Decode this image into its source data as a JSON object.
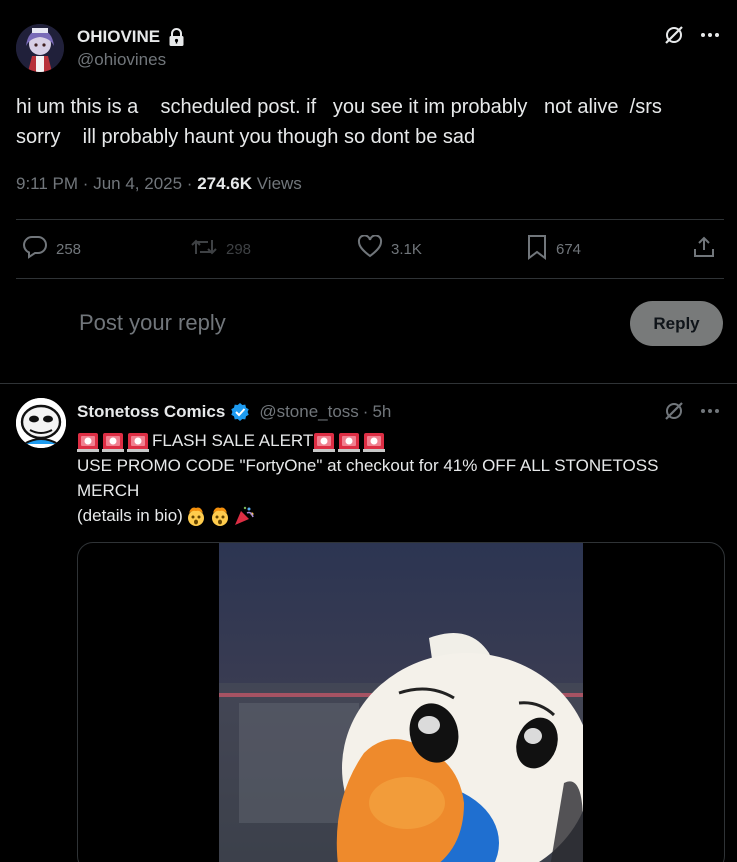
{
  "main_post": {
    "display_name": "OHIOVINE",
    "handle": "@ohiovines",
    "text": "hi um this is a    scheduled post. if   you see it im probably   not alive  /srs\nsorry    ill probably haunt you though so dont be sad",
    "time": "9:11 PM",
    "sep1": "·",
    "date": "Jun 4, 2025",
    "sep2": "·",
    "views_count": "274.6K",
    "views_label": "Views",
    "actions": {
      "replies": "258",
      "reposts": "298",
      "likes": "3.1K",
      "bookmarks": "674"
    }
  },
  "reply_composer": {
    "placeholder": "Post your reply",
    "button_label": "Reply"
  },
  "reply_post": {
    "display_name": "Stonetoss Comics",
    "handle": "@stone_toss",
    "sep": "·",
    "time": "5h",
    "line1_text": "FLASH SALE ALERT",
    "line2_text": "USE PROMO CODE \"FortyOne\" at checkout for 41% OFF ALL STONETOSS",
    "line3_text": "MERCH",
    "line4_text": "(details in bio)"
  },
  "colors": {
    "background": "#000000",
    "text_primary": "#e7e9ea",
    "text_secondary": "#71767b",
    "divider": "#2f3336",
    "verified": "#1d9bf0",
    "reply_button_bg": "#787a7a"
  }
}
